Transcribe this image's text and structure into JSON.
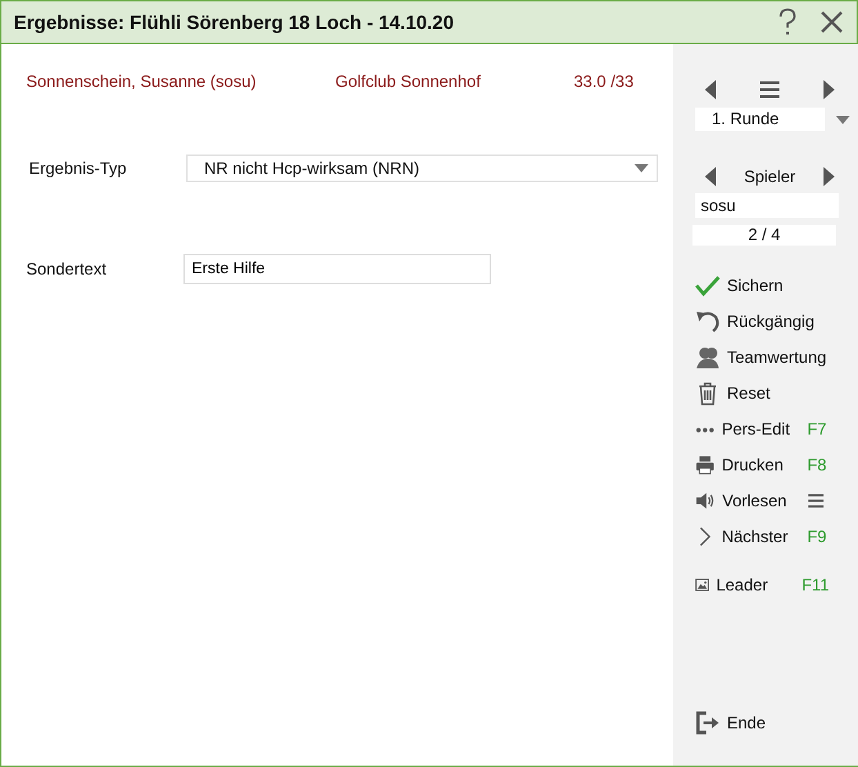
{
  "window": {
    "title": "Ergebnisse: Flühli Sörenberg 18 Loch - 14.10.20"
  },
  "player_info": {
    "name": "Sonnenschein, Susanne (sosu)",
    "club": "Golfclub Sonnenhof",
    "handicap": "33.0 /33"
  },
  "result_type": {
    "label": "Ergebnis-Typ",
    "value": "NR nicht Hcp-wirksam (NRN)"
  },
  "special_text": {
    "label": "Sondertext",
    "value": "Erste Hilfe"
  },
  "round_nav": {
    "value": "1. Runde"
  },
  "player_nav": {
    "label": "Spieler",
    "value": "sosu",
    "position": "2 / 4"
  },
  "actions": [
    {
      "label": "Sichern"
    },
    {
      "label": "Rückgängig"
    },
    {
      "label": "Teamwertung"
    },
    {
      "label": "Reset"
    },
    {
      "label": "Pers-Edit",
      "shortcut": "F7"
    },
    {
      "label": "Drucken",
      "shortcut": "F8"
    },
    {
      "label": "Vorlesen",
      "menu": true
    },
    {
      "label": "Nächster",
      "shortcut": "F9"
    },
    {
      "label": "Leader",
      "shortcut": "F11"
    }
  ],
  "exit": {
    "label": "Ende"
  }
}
